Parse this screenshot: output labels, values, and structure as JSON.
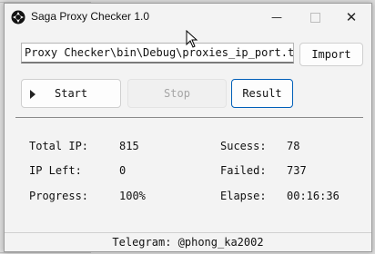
{
  "window": {
    "title": "Saga Proxy Checker 1.0"
  },
  "file": {
    "path": "Proxy Checker\\bin\\Debug\\proxies_ip_port.txt",
    "import_label": "Import"
  },
  "controls": {
    "start_label": "Start",
    "stop_label": "Stop",
    "result_label": "Result"
  },
  "stats": {
    "total_ip_label": "Total IP:",
    "total_ip_value": "815",
    "ip_left_label": "IP Left:",
    "ip_left_value": "0",
    "progress_label": "Progress:",
    "progress_value": "100%",
    "success_label": "Sucess:",
    "success_value": "78",
    "failed_label": "Failed:",
    "failed_value": "737",
    "elapse_label": "Elapse:",
    "elapse_value": "00:16:36"
  },
  "status": {
    "telegram": "Telegram: @phong_ka2002"
  },
  "colors": {
    "accent": "#005fb8",
    "window_bg": "#f3f3f3"
  },
  "icons": [
    "app-logo-icon",
    "minimize-icon",
    "maximize-icon",
    "close-icon",
    "play-icon",
    "mouse-cursor-icon"
  ]
}
